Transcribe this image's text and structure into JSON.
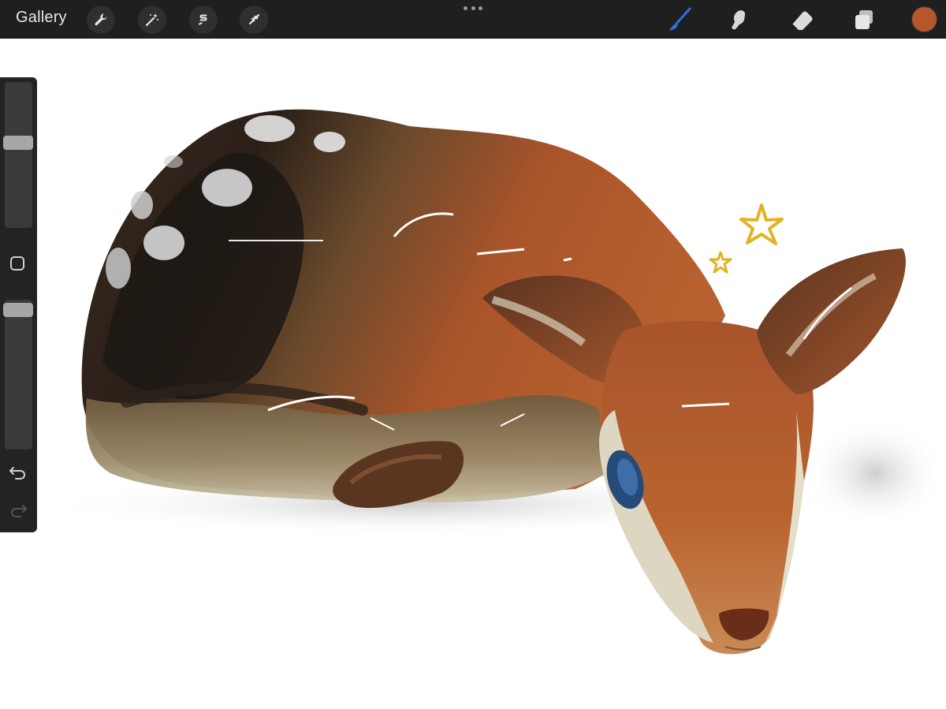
{
  "toolbar": {
    "gallery_label": "Gallery",
    "left_tools": [
      "wrench-icon",
      "magic-wand-icon",
      "selection-icon",
      "transform-arrow-icon"
    ],
    "right_tools": [
      "brush-icon",
      "smudge-icon",
      "eraser-icon",
      "layers-icon"
    ],
    "active_tool": "brush-icon",
    "current_color": "#b5562b",
    "accent_color": "#2e6fe0"
  },
  "sidebar": {
    "brush_size_level": 0.42,
    "opacity_level": 0.06
  },
  "canvas": {
    "subject": "painting-fawn"
  }
}
